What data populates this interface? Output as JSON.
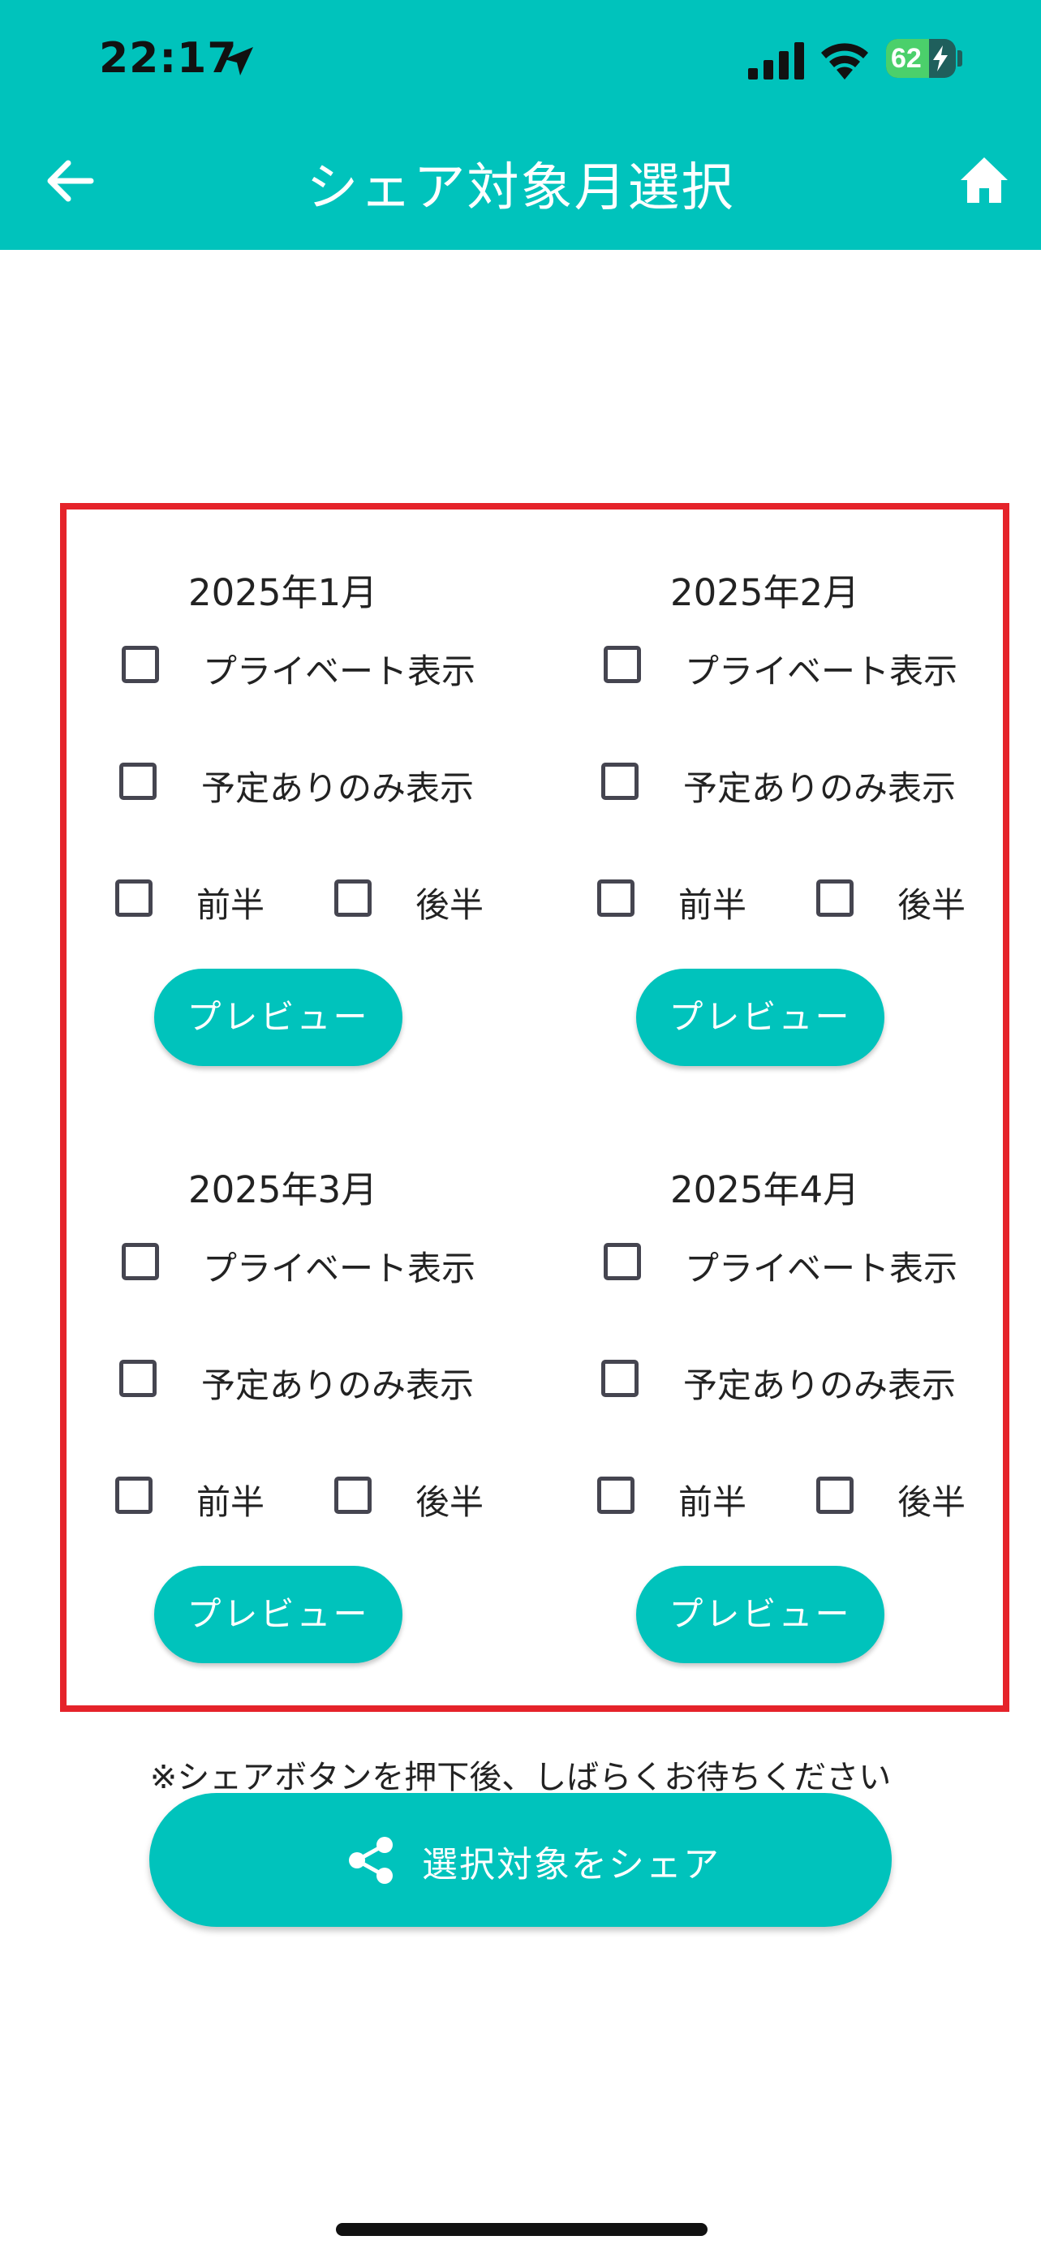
{
  "status_bar": {
    "time": "22:17",
    "battery": "62",
    "icons": [
      "location-arrow-icon",
      "cellular-signal-icon",
      "wifi-icon",
      "battery-charging-icon"
    ]
  },
  "header": {
    "title": "シェア対象月選択",
    "back_icon": "arrow-left-icon",
    "home_icon": "home-icon",
    "background": "#00c3bc"
  },
  "months": [
    {
      "title": "2025年1月",
      "private_label": "プライベート表示",
      "only_scheduled_label": "予定ありのみ表示",
      "first_half_label": "前半",
      "second_half_label": "後半",
      "preview_label": "プレビュー"
    },
    {
      "title": "2025年2月",
      "private_label": "プライベート表示",
      "only_scheduled_label": "予定ありのみ表示",
      "first_half_label": "前半",
      "second_half_label": "後半",
      "preview_label": "プレビュー"
    },
    {
      "title": "2025年3月",
      "private_label": "プライベート表示",
      "only_scheduled_label": "予定ありのみ表示",
      "first_half_label": "前半",
      "second_half_label": "後半",
      "preview_label": "プレビュー"
    },
    {
      "title": "2025年4月",
      "private_label": "プライベート表示",
      "only_scheduled_label": "予定ありのみ表示",
      "first_half_label": "前半",
      "second_half_label": "後半",
      "preview_label": "プレビュー"
    }
  ],
  "footer": {
    "note": "※シェアボタンを押下後、しばらくお待ちください",
    "share_label": "選択対象をシェア",
    "share_icon": "share-icon"
  },
  "colors": {
    "accent": "#00c3bc",
    "frame": "#e5232a",
    "checkbox_border": "#454550"
  }
}
